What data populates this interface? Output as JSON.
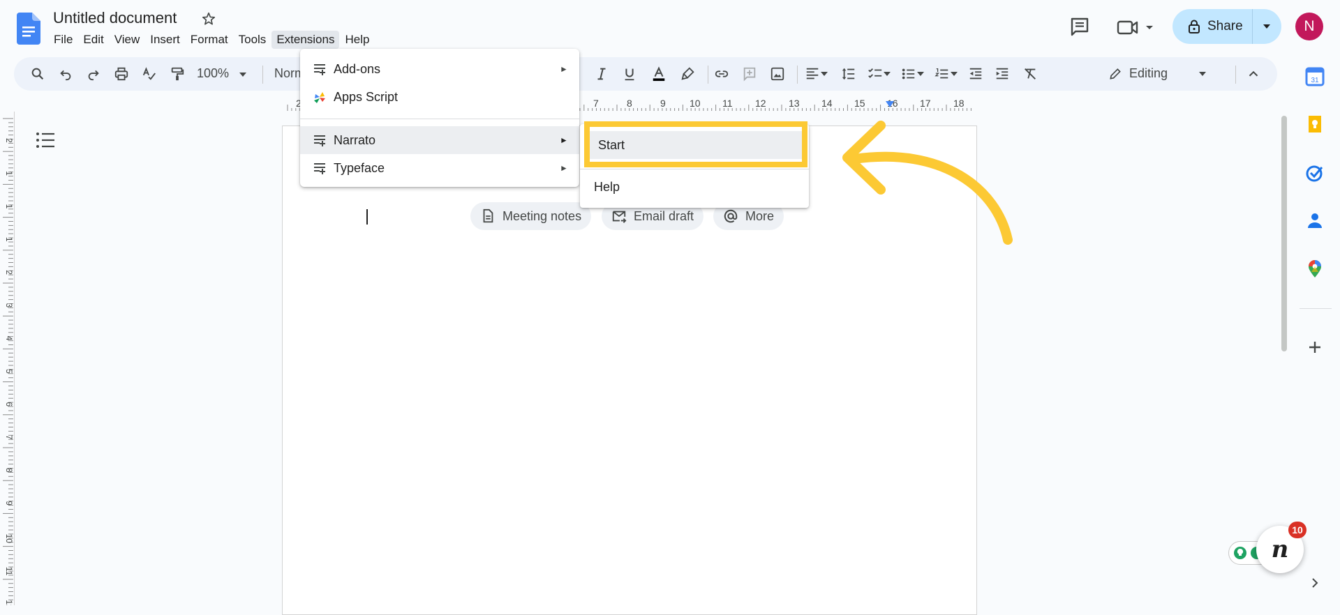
{
  "header": {
    "title": "Untitled document",
    "menus": [
      "File",
      "Edit",
      "View",
      "Insert",
      "Format",
      "Tools",
      "Extensions",
      "Help"
    ],
    "active_menu": "Extensions",
    "share_label": "Share",
    "avatar_letter": "N"
  },
  "toolbar": {
    "zoom": "100%",
    "style": "Normal text",
    "mode": "Editing"
  },
  "ruler": {
    "numbers": [
      "2",
      "7",
      "8",
      "9",
      "10",
      "11",
      "12",
      "13",
      "14",
      "15",
      "16",
      "17",
      "18"
    ]
  },
  "vertical_ruler": {
    "numbers": [
      "2",
      "1",
      "1",
      "1",
      "2",
      "3",
      "4",
      "5",
      "6",
      "7",
      "8",
      "9",
      "10",
      "11",
      "12"
    ]
  },
  "extensions_menu": {
    "items": [
      {
        "label": "Add-ons",
        "icon": "add-ons-icon",
        "submenu": true
      },
      {
        "label": "Apps Script",
        "icon": "apps-script-icon",
        "submenu": false
      },
      {
        "label": "Narrato",
        "icon": "add-on-list-icon",
        "submenu": true,
        "highlighted": true
      },
      {
        "label": "Typeface",
        "icon": "add-on-list-icon",
        "submenu": true
      }
    ]
  },
  "narrato_submenu": {
    "start_label": "Start",
    "help_label": "Help"
  },
  "smart_chips": {
    "meeting_notes": "Meeting notes",
    "email_draft": "Email draft",
    "more": "More"
  },
  "notifications": {
    "badge_count": "10",
    "fab_letter": "n"
  },
  "colors": {
    "accent": "#fcc934",
    "share_bg": "#c2e7ff",
    "avatar_bg": "#c2185b",
    "toolbar_bg": "#edf2fa",
    "menu_active": "#e3e7ec"
  }
}
